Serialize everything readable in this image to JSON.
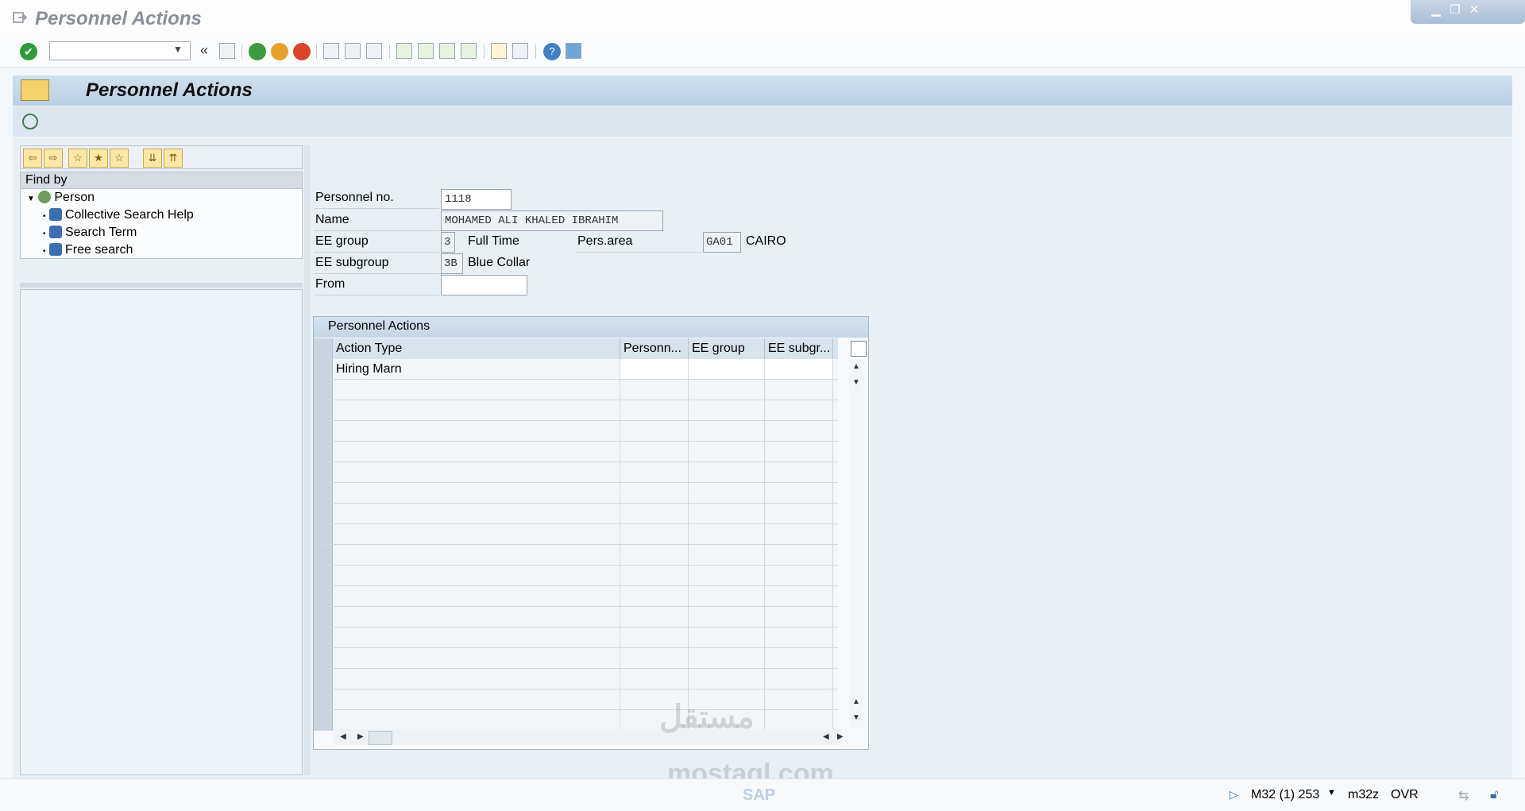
{
  "window": {
    "title": "Personnel Actions"
  },
  "toolbar": {
    "command_field_value": "",
    "icons": [
      "enter-icon",
      "save-icon",
      "back-icon",
      "exit-icon",
      "cancel-icon",
      "print-icon",
      "find-icon",
      "find-next-icon",
      "first-page-icon",
      "previous-page-icon",
      "next-page-icon",
      "last-page-icon",
      "create-session-icon",
      "shortcut-icon",
      "help-icon",
      "layout-icon"
    ]
  },
  "screen": {
    "title": "Personnel Actions"
  },
  "nav": {
    "find_by_label": "Find by",
    "tree_root": "Person",
    "tree_items": [
      "Collective Search Help",
      "Search Term",
      "Free search"
    ]
  },
  "form": {
    "personnel_no_label": "Personnel no.",
    "personnel_no_value": "1118",
    "name_label": "Name",
    "name_value": "MOHAMED ALI KHALED IBRAHIM",
    "ee_group_label": "EE group",
    "ee_group_code": "3",
    "ee_group_text": "Full Time",
    "pers_area_label": "Pers.area",
    "pers_area_code": "GA01",
    "pers_area_text": "CAIRO",
    "ee_subgroup_label": "EE subgroup",
    "ee_subgroup_code": "3B",
    "ee_subgroup_text": "Blue Collar",
    "from_label": "From",
    "from_value": ""
  },
  "table": {
    "title": "Personnel Actions",
    "columns": [
      "Action Type",
      "Personn...",
      "EE group",
      "EE subgr..."
    ],
    "rows": [
      [
        "Hiring Marn",
        "",
        "",
        ""
      ]
    ]
  },
  "status": {
    "system": "M32 (1) 253",
    "client": "m32z",
    "mode": "OVR"
  },
  "watermark": {
    "arabic": "مستقل",
    "latin": "mostaql.com",
    "sap": "SAP"
  },
  "colors": {
    "header_gradient": "#b9d0e4",
    "work_area": "#e8eff5",
    "toolbar_green": "#2e9b3a"
  }
}
